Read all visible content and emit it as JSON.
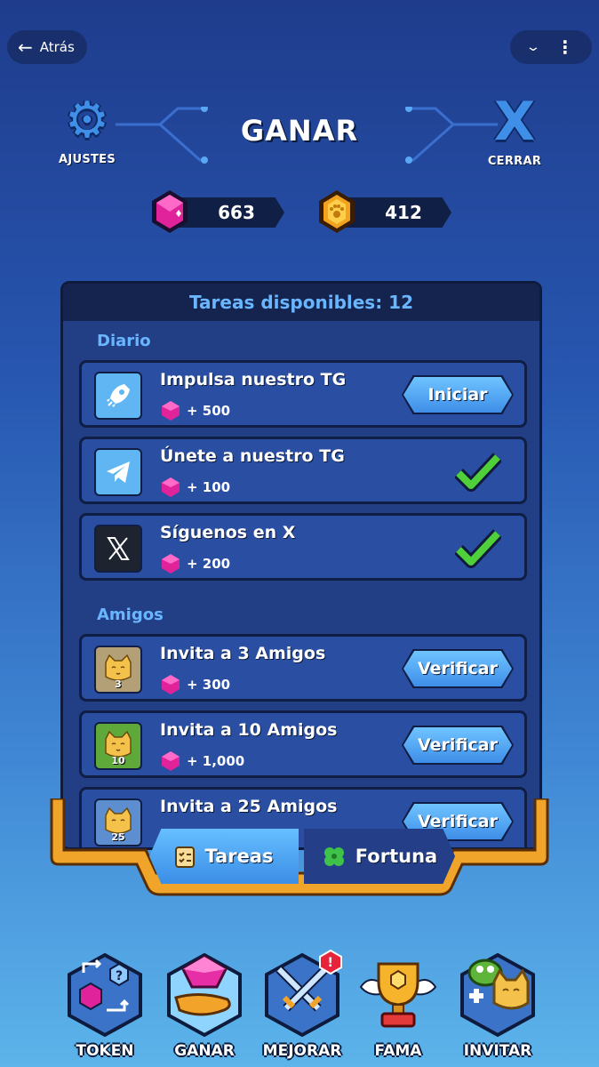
{
  "topbar": {
    "back_label": "Atrás"
  },
  "header": {
    "title": "GANAR",
    "settings_label": "AJUSTES",
    "close_label": "CERRAR"
  },
  "balances": {
    "gems": "663",
    "coins": "412"
  },
  "panel": {
    "heading": "Tareas disponibles: 12",
    "sections": {
      "daily": {
        "title": "Diario",
        "tasks": [
          {
            "title": "Impulsa nuestro TG",
            "reward": "+ 500",
            "action": "Iniciar",
            "icon": "rocket-icon"
          },
          {
            "title": "Únete a nuestro TG",
            "reward": "+ 100",
            "status": "done",
            "icon": "telegram-icon"
          },
          {
            "title": "Síguenos en X",
            "reward": "+ 200",
            "status": "done",
            "icon": "x-icon"
          }
        ]
      },
      "friends": {
        "title": "Amigos",
        "tasks": [
          {
            "title": "Invita a 3 Amigos",
            "reward": "+ 300",
            "action": "Verificar",
            "count": "3"
          },
          {
            "title": "Invita a 10 Amigos",
            "reward": "+ 1,000",
            "action": "Verificar",
            "count": "10"
          },
          {
            "title": "Invita a 25 Amigos",
            "action": "Verificar",
            "count": "25"
          }
        ]
      }
    }
  },
  "tabs": {
    "tasks": "Tareas",
    "fortune": "Fortuna"
  },
  "nav": {
    "token": "TOKEN",
    "earn": "GANAR",
    "upgrade": "MEJORAR",
    "fame": "FAMA",
    "invite": "INVITAR",
    "upgrade_badge": "!"
  },
  "colors": {
    "accent": "#3e8ee8",
    "panel": "#223f86",
    "gem": "#e0239a",
    "coin": "#f2a420",
    "frame": "#f0a52a"
  }
}
